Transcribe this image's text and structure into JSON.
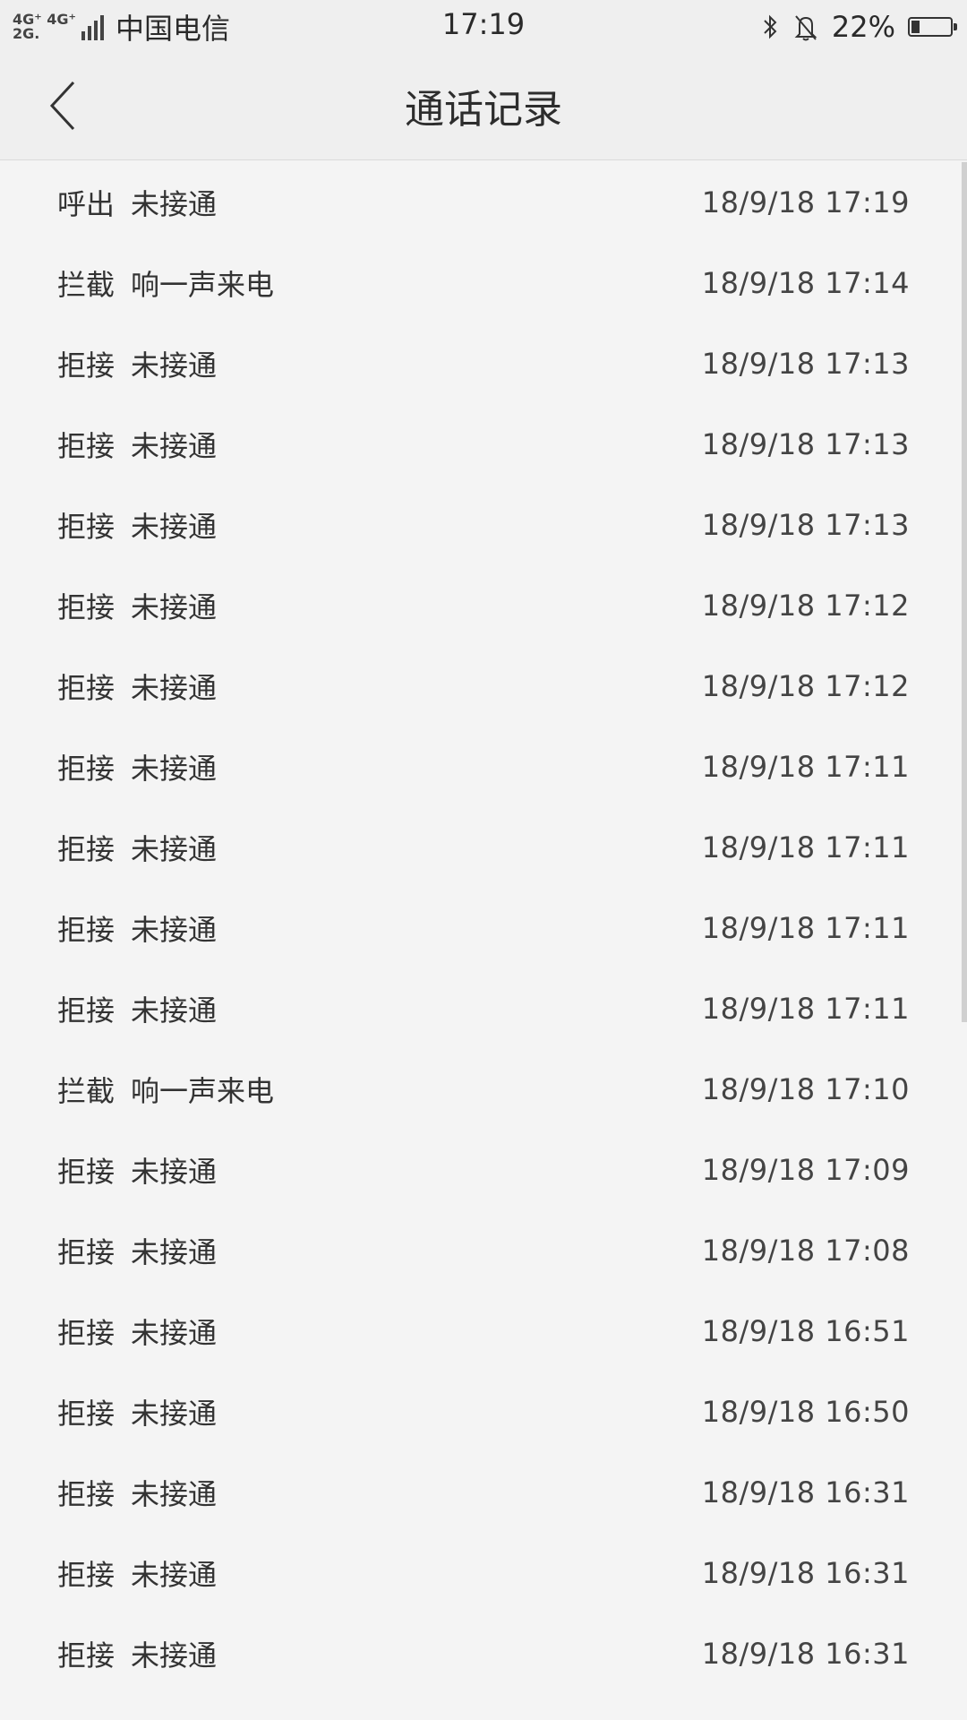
{
  "status_bar": {
    "net_top": "4G⁺ 4G⁺",
    "net_bottom": "2G.",
    "carrier": "中国电信",
    "time": "17:19",
    "battery_percent": "22%",
    "battery_level": 0.22
  },
  "header": {
    "title": "通话记录",
    "back_icon": "chevron-left-icon"
  },
  "records": [
    {
      "type": "呼出",
      "status": "未接通",
      "time": "18/9/18 17:19"
    },
    {
      "type": "拦截",
      "status": "响一声来电",
      "time": "18/9/18 17:14"
    },
    {
      "type": "拒接",
      "status": "未接通",
      "time": "18/9/18 17:13"
    },
    {
      "type": "拒接",
      "status": "未接通",
      "time": "18/9/18 17:13"
    },
    {
      "type": "拒接",
      "status": "未接通",
      "time": "18/9/18 17:13"
    },
    {
      "type": "拒接",
      "status": "未接通",
      "time": "18/9/18 17:12"
    },
    {
      "type": "拒接",
      "status": "未接通",
      "time": "18/9/18 17:12"
    },
    {
      "type": "拒接",
      "status": "未接通",
      "time": "18/9/18 17:11"
    },
    {
      "type": "拒接",
      "status": "未接通",
      "time": "18/9/18 17:11"
    },
    {
      "type": "拒接",
      "status": "未接通",
      "time": "18/9/18 17:11"
    },
    {
      "type": "拒接",
      "status": "未接通",
      "time": "18/9/18 17:11"
    },
    {
      "type": "拦截",
      "status": "响一声来电",
      "time": "18/9/18 17:10"
    },
    {
      "type": "拒接",
      "status": "未接通",
      "time": "18/9/18 17:09"
    },
    {
      "type": "拒接",
      "status": "未接通",
      "time": "18/9/18 17:08"
    },
    {
      "type": "拒接",
      "status": "未接通",
      "time": "18/9/18 16:51"
    },
    {
      "type": "拒接",
      "status": "未接通",
      "time": "18/9/18 16:50"
    },
    {
      "type": "拒接",
      "status": "未接通",
      "time": "18/9/18 16:31"
    },
    {
      "type": "拒接",
      "status": "未接通",
      "time": "18/9/18 16:31"
    },
    {
      "type": "拒接",
      "status": "未接通",
      "time": "18/9/18 16:31"
    }
  ]
}
